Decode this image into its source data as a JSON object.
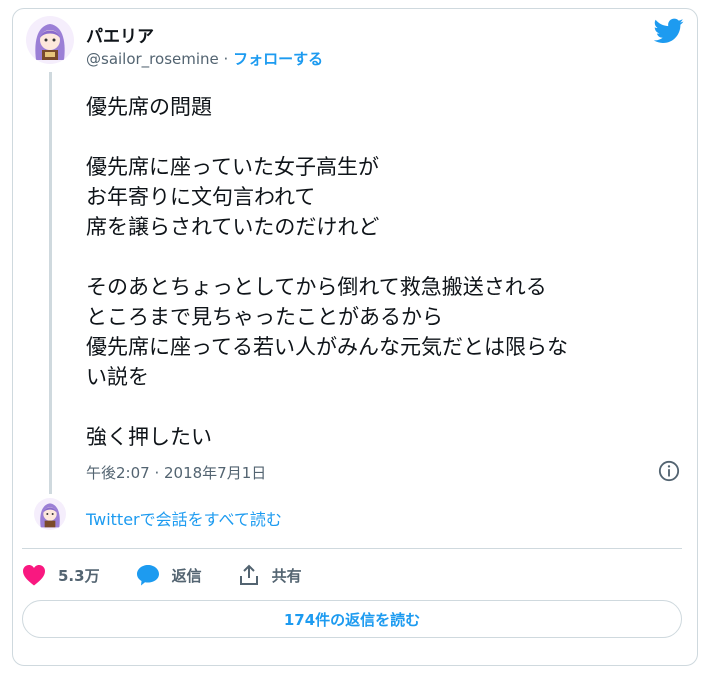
{
  "author": {
    "display_name": "パエリア",
    "handle": "@sailor_rosemine",
    "separator": "·",
    "follow_label": "フォローする"
  },
  "tweet": {
    "paragraphs": [
      [
        "優先席の問題"
      ],
      [
        "優先席に座っていた女子高生が",
        "お年寄りに文句言われて",
        "席を譲らされていたのだけれど"
      ],
      [
        "そのあとちょっとしてから倒れて救急搬送される",
        "ところまで見ちゃったことがあるから",
        "優先席に座ってる若い人がみんな元気だとは限らな",
        "い説を"
      ],
      [
        "強く押したい"
      ]
    ],
    "timestamp": "午後2:07 · 2018年7月1日"
  },
  "conversation_link": "Twitterで会話をすべて読む",
  "actions": {
    "like_count": "5.3万",
    "reply_label": "返信",
    "share_label": "共有"
  },
  "read_replies_button": "174件の返信を読む",
  "colors": {
    "accent": "#1d9bf0",
    "like": "#f91880",
    "border": "#cfd9de",
    "secondary_text": "#536471"
  },
  "icons": [
    "twitter-bird-icon",
    "info-icon",
    "heart-icon",
    "reply-bubble-icon",
    "share-icon"
  ]
}
